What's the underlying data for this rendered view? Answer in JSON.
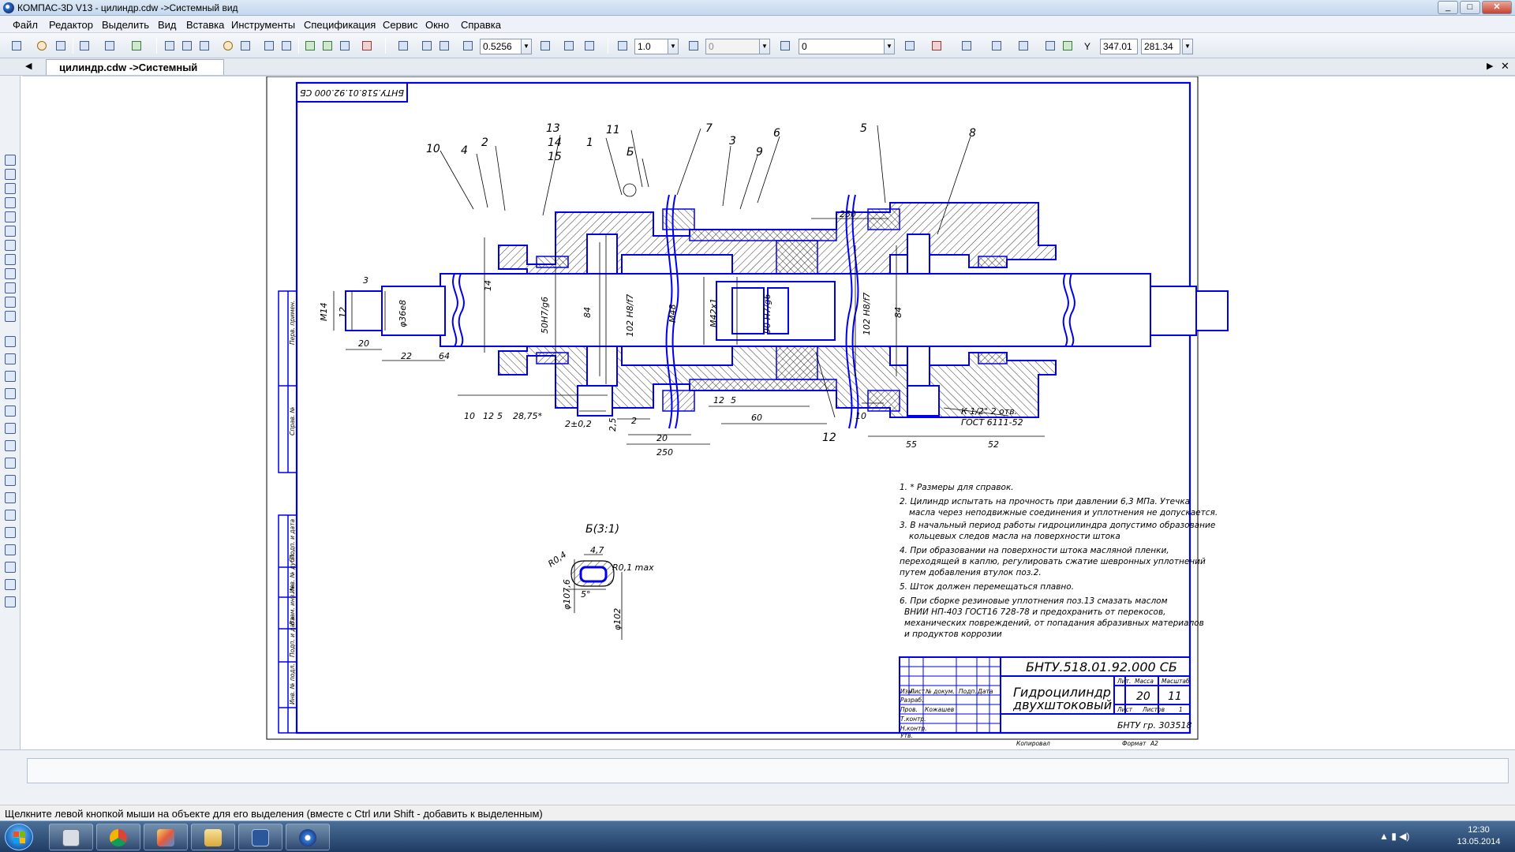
{
  "window": {
    "title": "КОМПАС-3D V13 - цилиндр.cdw ->Системный вид",
    "btn_min": "_",
    "btn_max": "□",
    "btn_close": "✕"
  },
  "menu": [
    "Файл",
    "Редактор",
    "Выделить",
    "Вид",
    "Вставка",
    "Инструменты",
    "Спецификация",
    "Сервис",
    "Окно",
    "Справка"
  ],
  "toolbar": {
    "zoom": "0.5256",
    "step": "1.0",
    "layer_state": "0",
    "style": "0",
    "coord_x_label": "Y",
    "coord_x": "347.01",
    "coord_y": "281.34"
  },
  "doc_tab": "цилиндр.cdw ->Системный вид",
  "drawing": {
    "stamp_top": "БНТУ.518.01.92.000 СБ",
    "positions": [
      "10",
      "4",
      "2",
      "13",
      "14",
      "15",
      "1",
      "11",
      "Б",
      "7",
      "3",
      "9",
      "6",
      "5",
      "8",
      "12"
    ],
    "dims": [
      "250",
      "3",
      "M14",
      "12",
      "φ36e8",
      "20",
      "22",
      "64",
      "14",
      "50H7/g6",
      "84",
      "102 H8/f7",
      "M48",
      "M42x1",
      "90 H7/g6",
      "102 H8/f7",
      "84",
      "10",
      "12",
      "5",
      "28,75*",
      "2±0,2",
      "2,5",
      "2",
      "20",
      "250",
      "12",
      "5",
      "60",
      "10",
      "55",
      "52",
      "К 1/2\" 2 отв.",
      "ГОСТ 6111-52"
    ],
    "detail_title": "Б(3:1)",
    "detail_dims": [
      "4,7",
      "R0,4",
      "R0,1 max",
      "φ107,6",
      "φ102",
      "5°"
    ],
    "notes": [
      "1. * Размеры для справок.",
      "2. Цилиндр испытать на прочность при давлении 6,3 МПа. Утечка",
      "масла через неподвижные соединения и уплотнения не допускается.",
      "3. В начальный период работы гидроцилиндра допустимо образование",
      "кольцевых следов масла на поверхности штока",
      "4. При образовании на поверхности штока масляной пленки,",
      "переходящей в каплю, регулировать сжатие шевронных уплотнений",
      "путем добавления втулок поз.2.",
      "5. Шток должен перемещаться плавно.",
      "6. При сборке резиновые уплотнения поз.13 смазать маслом",
      "ВНИИ НП-403 ГОСТ16 728-78 и предохранить от перекосов,",
      "механических повреждений, от попадания абразивных материалов",
      "и продуктов коррозии"
    ],
    "titleblock": {
      "code": "БНТУ.518.01.92.000 СБ",
      "name1": "Гидроцилиндр",
      "name2": "двухштоковый",
      "lit": "Лит.",
      "mass": "Масса",
      "scale": "Масштаб",
      "mass_val": "20",
      "scale_val": "11",
      "sheet": "Лист",
      "sheets": "Листов",
      "sheets_val": "1",
      "group": "БНТУ гр. 303518",
      "izm": "Изм.",
      "list": "Лист",
      "doc": "№ докум.",
      "sign": "Подп.",
      "date": "Дата",
      "razrab": "Разраб.",
      "prov": "Пров.",
      "tkontr": "Т.контр.",
      "nkontr": "Н.контр.",
      "utv": "Утв.",
      "surname": "Кожашев",
      "copied": "Копировал",
      "format": "Формат",
      "format_val": "А2"
    },
    "sidebar_labels": [
      "Перв. примен.",
      "Справ. №",
      "Подп. и дата",
      "Инв. № дубл.",
      "Взам. инв. №",
      "Подп. и дата",
      "Инв. № подл."
    ]
  },
  "status_text": "Щелкните левой кнопкой мыши на объекте для его выделения (вместе с Ctrl или Shift - добавить к выделенным)",
  "taskbar": {
    "time": "12:30",
    "date": "13.05.2014"
  },
  "colors": {
    "outline": "#0000ee",
    "axis": "#ff8000",
    "hatch": "#000000",
    "window_bg": "#eef2f7"
  }
}
